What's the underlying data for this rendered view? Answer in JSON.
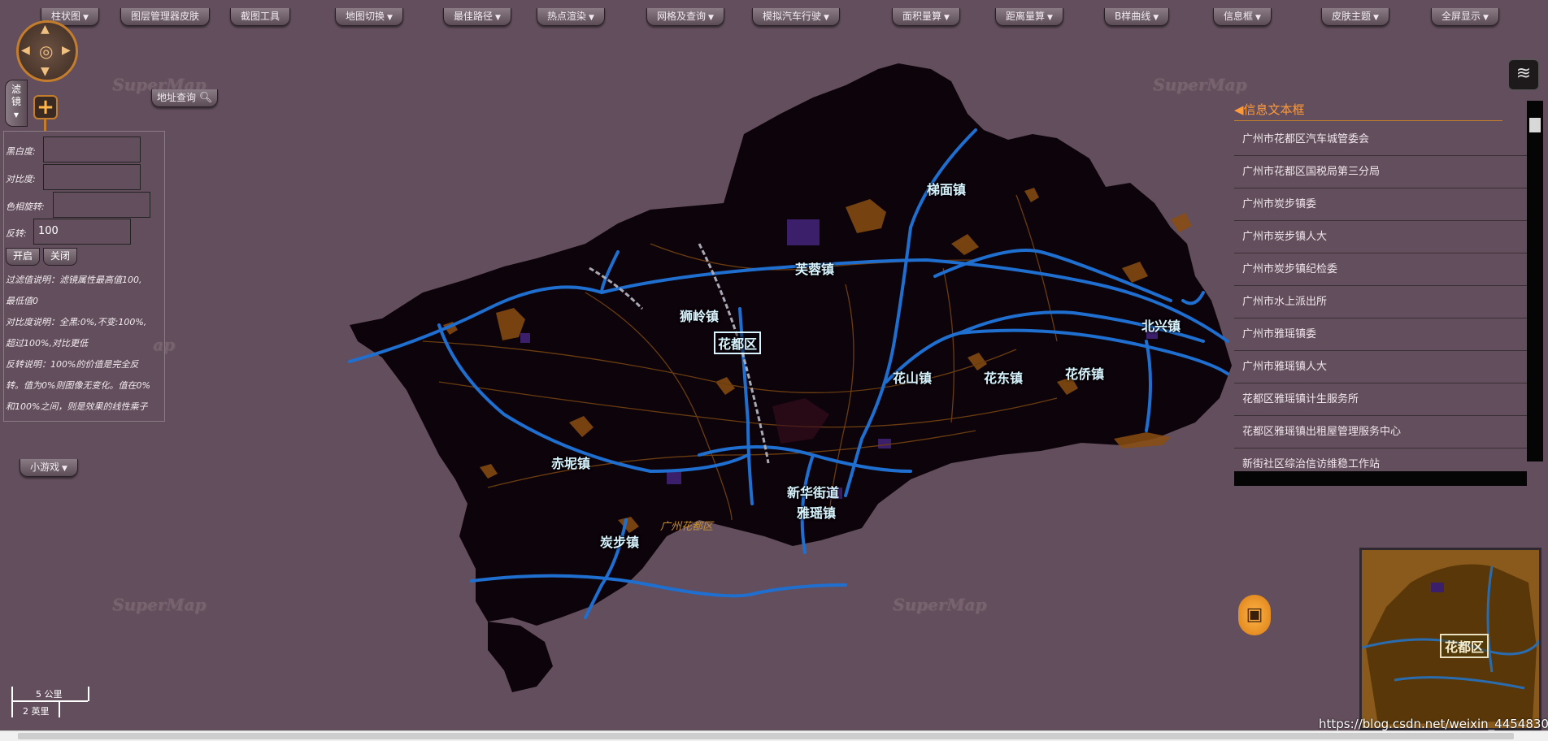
{
  "toolbar": {
    "items": [
      {
        "label": "柱状图",
        "caret": true
      },
      {
        "label": "图层管理器皮肤",
        "caret": false
      },
      {
        "label": "截图工具",
        "caret": false
      },
      {
        "label": "地图切换",
        "caret": true
      },
      {
        "label": "最佳路径",
        "caret": true
      },
      {
        "label": "热点渲染",
        "caret": true
      },
      {
        "label": "网格及查询",
        "caret": true
      },
      {
        "label": "模拟汽车行驶",
        "caret": true
      },
      {
        "label": "面积量算",
        "caret": true
      },
      {
        "label": "距离量算",
        "caret": true
      },
      {
        "label": "B样曲线",
        "caret": true
      },
      {
        "label": "信息框",
        "caret": true
      },
      {
        "label": "皮肤主题",
        "caret": true
      },
      {
        "label": "全屏显示",
        "caret": true
      }
    ]
  },
  "filter": {
    "tab_label": "滤镜",
    "fields": [
      {
        "label": "黑白度:",
        "value": ""
      },
      {
        "label": "对比度:",
        "value": ""
      },
      {
        "label": "色相旋转:",
        "value": ""
      },
      {
        "label": "反转:",
        "value": "100"
      }
    ],
    "open_label": "开启",
    "close_label": "关闭",
    "notes": [
      "过滤值说明：滤镜属性最高值100,",
      "最低值0",
      "对比度说明：全黑:0%,不变:100%,",
      "超过100%,对比更低",
      "反转说明：100%的价值是完全反",
      "转。值为0%则图像无变化。值在0%",
      "和100%之间，则是效果的线性乘子"
    ]
  },
  "address_query_label": "地址查询",
  "mini_game_label": "小游戏",
  "map": {
    "watermark": "SuperMap",
    "district_label": "花都区",
    "map_sub_label": "广州花都区",
    "places": [
      "梯面镇",
      "芙蓉镇",
      "狮岭镇",
      "北兴镇",
      "花山镇",
      "花东镇",
      "花侨镇",
      "赤坭镇",
      "新华街道",
      "雅瑶镇",
      "炭步镇"
    ]
  },
  "info_box": {
    "title": "信息文本框",
    "items": [
      "广州市花都区汽车城管委会",
      "广州市花都区国税局第三分局",
      "广州市炭步镇委",
      "广州市炭步镇人大",
      "广州市炭步镇纪检委",
      "广州市水上派出所",
      "广州市雅瑶镇委",
      "广州市雅瑶镇人大",
      "花都区雅瑶镇计生服务所",
      "花都区雅瑶镇出租屋管理服务中心",
      "新街社区综治信访维稳工作站"
    ]
  },
  "overview_label": "花都区",
  "scale": {
    "metric": "5 公里",
    "imperial": "2 英里"
  },
  "footer_url": "https://blog.csdn.net/weixin_44548307",
  "colors": {
    "background": "#624e5c",
    "land": "#0d030b",
    "road": "#1f6fd0",
    "accent": "#c47d2c",
    "label": "#d8f4ff"
  }
}
